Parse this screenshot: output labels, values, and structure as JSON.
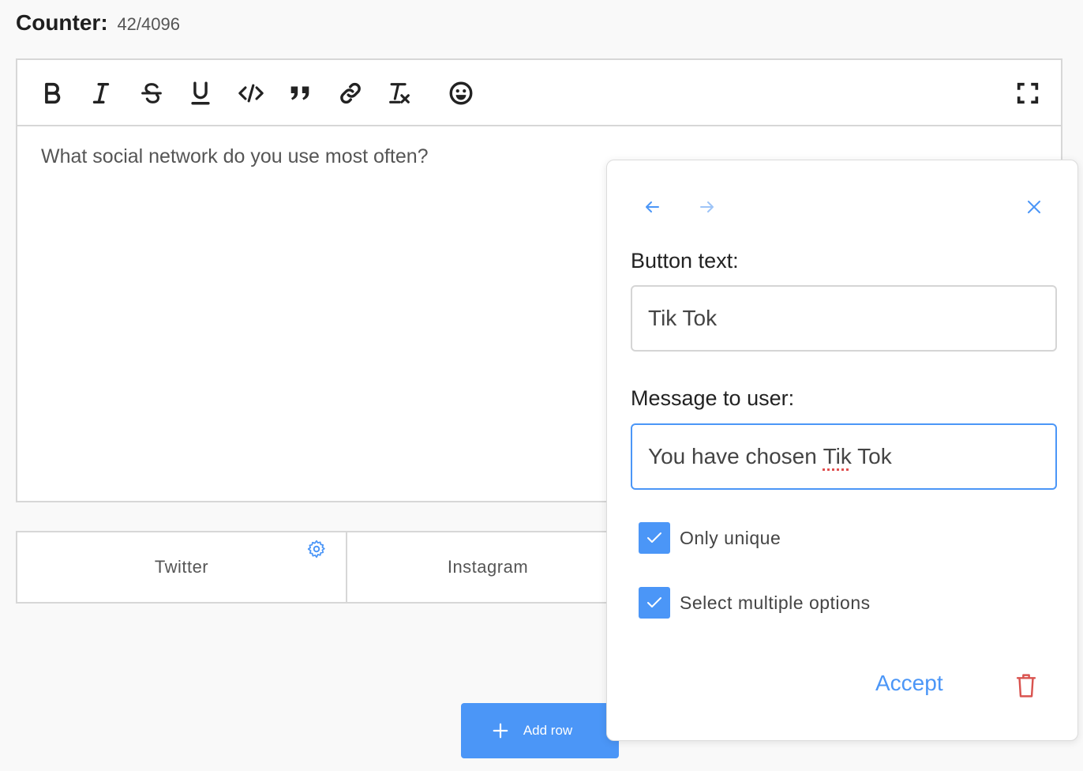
{
  "counter": {
    "label": "Counter:",
    "value": "42/4096"
  },
  "editor": {
    "text": "What social network do you use most often?",
    "toolbar": [
      "bold-icon",
      "italic-icon",
      "strikethrough-icon",
      "underline-icon",
      "code-icon",
      "quote-icon",
      "link-icon",
      "clear-format-icon",
      "emoji-icon",
      "fullscreen-icon"
    ]
  },
  "buttons": [
    {
      "label": "Twitter"
    },
    {
      "label": "Instagram"
    }
  ],
  "add_row": {
    "label": "Add row"
  },
  "popup": {
    "button_text_label": "Button text:",
    "button_text_value": "Tik Tok",
    "message_label": "Message to user:",
    "message_prefix": "You have chosen ",
    "message_misspelled": "Tik",
    "message_suffix": " Tok",
    "only_unique_label": "Only unique",
    "only_unique_checked": true,
    "multiple_label": "Select multiple options",
    "multiple_checked": true,
    "accept_label": "Accept"
  },
  "colors": {
    "accent": "#4b96f7",
    "danger": "#d9534f",
    "border": "#d7d7d7"
  }
}
